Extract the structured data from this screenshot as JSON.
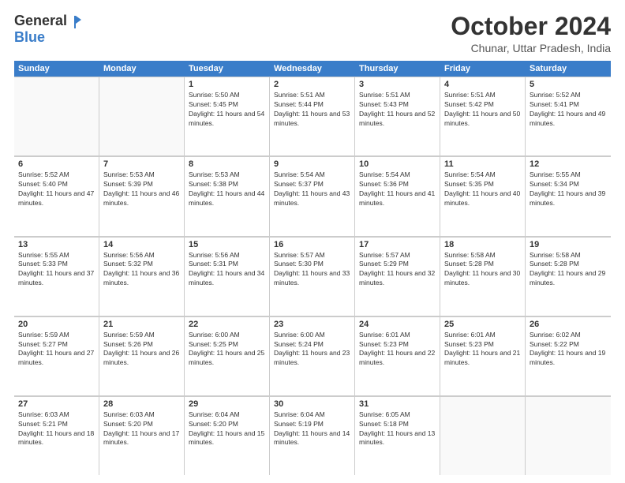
{
  "header": {
    "logo_general": "General",
    "logo_blue": "Blue",
    "month_title": "October 2024",
    "location": "Chunar, Uttar Pradesh, India"
  },
  "calendar": {
    "day_headers": [
      "Sunday",
      "Monday",
      "Tuesday",
      "Wednesday",
      "Thursday",
      "Friday",
      "Saturday"
    ],
    "rows": [
      [
        {
          "day": "",
          "empty": true
        },
        {
          "day": "",
          "empty": true
        },
        {
          "day": "1",
          "sunrise": "Sunrise: 5:50 AM",
          "sunset": "Sunset: 5:45 PM",
          "daylight": "Daylight: 11 hours and 54 minutes."
        },
        {
          "day": "2",
          "sunrise": "Sunrise: 5:51 AM",
          "sunset": "Sunset: 5:44 PM",
          "daylight": "Daylight: 11 hours and 53 minutes."
        },
        {
          "day": "3",
          "sunrise": "Sunrise: 5:51 AM",
          "sunset": "Sunset: 5:43 PM",
          "daylight": "Daylight: 11 hours and 52 minutes."
        },
        {
          "day": "4",
          "sunrise": "Sunrise: 5:51 AM",
          "sunset": "Sunset: 5:42 PM",
          "daylight": "Daylight: 11 hours and 50 minutes."
        },
        {
          "day": "5",
          "sunrise": "Sunrise: 5:52 AM",
          "sunset": "Sunset: 5:41 PM",
          "daylight": "Daylight: 11 hours and 49 minutes."
        }
      ],
      [
        {
          "day": "6",
          "sunrise": "Sunrise: 5:52 AM",
          "sunset": "Sunset: 5:40 PM",
          "daylight": "Daylight: 11 hours and 47 minutes."
        },
        {
          "day": "7",
          "sunrise": "Sunrise: 5:53 AM",
          "sunset": "Sunset: 5:39 PM",
          "daylight": "Daylight: 11 hours and 46 minutes."
        },
        {
          "day": "8",
          "sunrise": "Sunrise: 5:53 AM",
          "sunset": "Sunset: 5:38 PM",
          "daylight": "Daylight: 11 hours and 44 minutes."
        },
        {
          "day": "9",
          "sunrise": "Sunrise: 5:54 AM",
          "sunset": "Sunset: 5:37 PM",
          "daylight": "Daylight: 11 hours and 43 minutes."
        },
        {
          "day": "10",
          "sunrise": "Sunrise: 5:54 AM",
          "sunset": "Sunset: 5:36 PM",
          "daylight": "Daylight: 11 hours and 41 minutes."
        },
        {
          "day": "11",
          "sunrise": "Sunrise: 5:54 AM",
          "sunset": "Sunset: 5:35 PM",
          "daylight": "Daylight: 11 hours and 40 minutes."
        },
        {
          "day": "12",
          "sunrise": "Sunrise: 5:55 AM",
          "sunset": "Sunset: 5:34 PM",
          "daylight": "Daylight: 11 hours and 39 minutes."
        }
      ],
      [
        {
          "day": "13",
          "sunrise": "Sunrise: 5:55 AM",
          "sunset": "Sunset: 5:33 PM",
          "daylight": "Daylight: 11 hours and 37 minutes."
        },
        {
          "day": "14",
          "sunrise": "Sunrise: 5:56 AM",
          "sunset": "Sunset: 5:32 PM",
          "daylight": "Daylight: 11 hours and 36 minutes."
        },
        {
          "day": "15",
          "sunrise": "Sunrise: 5:56 AM",
          "sunset": "Sunset: 5:31 PM",
          "daylight": "Daylight: 11 hours and 34 minutes."
        },
        {
          "day": "16",
          "sunrise": "Sunrise: 5:57 AM",
          "sunset": "Sunset: 5:30 PM",
          "daylight": "Daylight: 11 hours and 33 minutes."
        },
        {
          "day": "17",
          "sunrise": "Sunrise: 5:57 AM",
          "sunset": "Sunset: 5:29 PM",
          "daylight": "Daylight: 11 hours and 32 minutes."
        },
        {
          "day": "18",
          "sunrise": "Sunrise: 5:58 AM",
          "sunset": "Sunset: 5:28 PM",
          "daylight": "Daylight: 11 hours and 30 minutes."
        },
        {
          "day": "19",
          "sunrise": "Sunrise: 5:58 AM",
          "sunset": "Sunset: 5:28 PM",
          "daylight": "Daylight: 11 hours and 29 minutes."
        }
      ],
      [
        {
          "day": "20",
          "sunrise": "Sunrise: 5:59 AM",
          "sunset": "Sunset: 5:27 PM",
          "daylight": "Daylight: 11 hours and 27 minutes."
        },
        {
          "day": "21",
          "sunrise": "Sunrise: 5:59 AM",
          "sunset": "Sunset: 5:26 PM",
          "daylight": "Daylight: 11 hours and 26 minutes."
        },
        {
          "day": "22",
          "sunrise": "Sunrise: 6:00 AM",
          "sunset": "Sunset: 5:25 PM",
          "daylight": "Daylight: 11 hours and 25 minutes."
        },
        {
          "day": "23",
          "sunrise": "Sunrise: 6:00 AM",
          "sunset": "Sunset: 5:24 PM",
          "daylight": "Daylight: 11 hours and 23 minutes."
        },
        {
          "day": "24",
          "sunrise": "Sunrise: 6:01 AM",
          "sunset": "Sunset: 5:23 PM",
          "daylight": "Daylight: 11 hours and 22 minutes."
        },
        {
          "day": "25",
          "sunrise": "Sunrise: 6:01 AM",
          "sunset": "Sunset: 5:23 PM",
          "daylight": "Daylight: 11 hours and 21 minutes."
        },
        {
          "day": "26",
          "sunrise": "Sunrise: 6:02 AM",
          "sunset": "Sunset: 5:22 PM",
          "daylight": "Daylight: 11 hours and 19 minutes."
        }
      ],
      [
        {
          "day": "27",
          "sunrise": "Sunrise: 6:03 AM",
          "sunset": "Sunset: 5:21 PM",
          "daylight": "Daylight: 11 hours and 18 minutes."
        },
        {
          "day": "28",
          "sunrise": "Sunrise: 6:03 AM",
          "sunset": "Sunset: 5:20 PM",
          "daylight": "Daylight: 11 hours and 17 minutes."
        },
        {
          "day": "29",
          "sunrise": "Sunrise: 6:04 AM",
          "sunset": "Sunset: 5:20 PM",
          "daylight": "Daylight: 11 hours and 15 minutes."
        },
        {
          "day": "30",
          "sunrise": "Sunrise: 6:04 AM",
          "sunset": "Sunset: 5:19 PM",
          "daylight": "Daylight: 11 hours and 14 minutes."
        },
        {
          "day": "31",
          "sunrise": "Sunrise: 6:05 AM",
          "sunset": "Sunset: 5:18 PM",
          "daylight": "Daylight: 11 hours and 13 minutes."
        },
        {
          "day": "",
          "empty": true
        },
        {
          "day": "",
          "empty": true
        }
      ]
    ]
  }
}
